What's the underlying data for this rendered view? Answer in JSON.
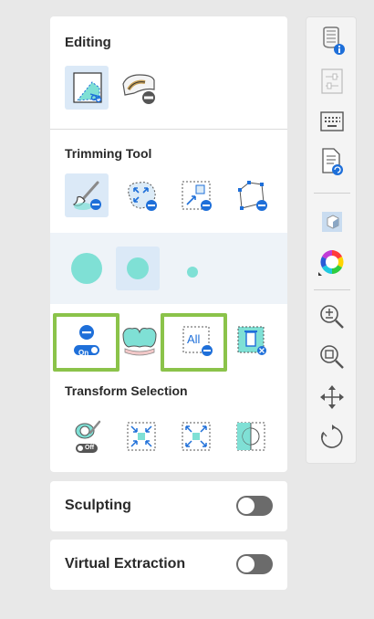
{
  "editing": {
    "title": "Editing"
  },
  "trimming": {
    "title": "Trimming Tool"
  },
  "transform": {
    "title": "Transform Selection"
  },
  "toggles": {
    "on_label": "On",
    "off_label": "Off",
    "all_label": "All"
  },
  "sculpting": {
    "label": "Sculpting",
    "enabled": false
  },
  "virtual_extraction": {
    "label": "Virtual Extraction",
    "enabled": false
  },
  "colors": {
    "accent": "#1e6fd9",
    "teal": "#7fe0d5",
    "highlight": "#8bc34a",
    "selected_bg": "#dbe9f7"
  },
  "icons": {
    "editing": [
      "trim-crop-icon",
      "tooth-remove-icon"
    ],
    "trimming": [
      "brush-trim-icon",
      "freeform-select-icon",
      "box-select-icon",
      "polygon-select-icon"
    ],
    "brush_sizes": [
      "brush-large-icon",
      "brush-medium-icon",
      "brush-small-icon"
    ],
    "trim_actions": [
      "select-toggle-on-icon",
      "connected-teeth-icon",
      "select-all-icon",
      "delete-selection-icon"
    ],
    "transform": [
      "brush-toggle-off-icon",
      "shrink-selection-icon",
      "expand-selection-icon",
      "invert-selection-icon"
    ],
    "toolbar": [
      "tooth-info-icon",
      "adjust-icon",
      "keyboard-icon",
      "document-icon",
      "view-cube-icon",
      "color-wheel-icon",
      "zoom-fit-icon",
      "zoom-icon",
      "pan-icon",
      "rotate-icon"
    ]
  }
}
